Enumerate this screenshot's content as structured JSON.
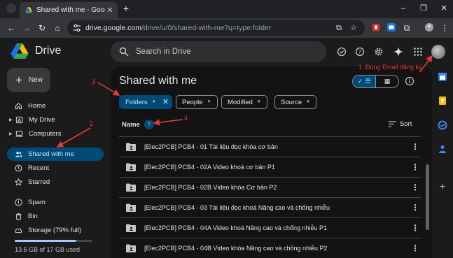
{
  "browser": {
    "tab_title": "Shared with me - Google Drive",
    "url_host": "drive.google.com",
    "url_path": "/drive/u/0/shared-with-me?q=type:folder"
  },
  "app": {
    "name": "Drive",
    "search_placeholder": "Search in Drive",
    "new_button": "New"
  },
  "sidebar": {
    "items": [
      {
        "label": "Home",
        "icon": "home-icon"
      },
      {
        "label": "My Drive",
        "icon": "my-drive-icon"
      },
      {
        "label": "Computers",
        "icon": "computer-icon"
      },
      {
        "label": "Shared with me",
        "icon": "shared-icon"
      },
      {
        "label": "Recent",
        "icon": "clock-icon"
      },
      {
        "label": "Starred",
        "icon": "star-icon"
      },
      {
        "label": "Spam",
        "icon": "spam-icon"
      },
      {
        "label": "Bin",
        "icon": "trash-icon"
      },
      {
        "label": "Storage (79% full)",
        "icon": "cloud-icon"
      }
    ],
    "storage_used_fraction": 0.79,
    "storage_text": "13.6 GB of 17 GB used"
  },
  "main": {
    "title": "Shared with me",
    "filters": {
      "folders": "Folders",
      "people": "People",
      "modified": "Modified",
      "source": "Source"
    },
    "column_name": "Name",
    "sort_label": "Sort",
    "rows": [
      "[Elec2PCB] PCB4 - 01 Tài liệu đọc khóa cơ bản",
      "[Elec2PCB] PCB4 - 02A Video khoá cơ bản P1",
      "[Elec2PCB] PCB4 - 02B Video khóa Cơ bản P2",
      "[Elec2PCB] PCB4 - 03 Tài liệu đọc khoá Nâng cao và chống nhiễu",
      "[Elec2PCB] PCB4 - 04A Video khoá Nâng cao và chống nhiễu P1",
      "[Elec2PCB] PCB4 - 04B Video khóa Nâng cao và chống nhiễu P2"
    ]
  },
  "annotations": {
    "a1": "1: Đúng Email đăng ký",
    "a2": "2",
    "a3": "3",
    "a4": "4"
  },
  "colors": {
    "accent": "#004a77",
    "accent_text": "#c2e7ff",
    "annotation": "#e53935"
  }
}
